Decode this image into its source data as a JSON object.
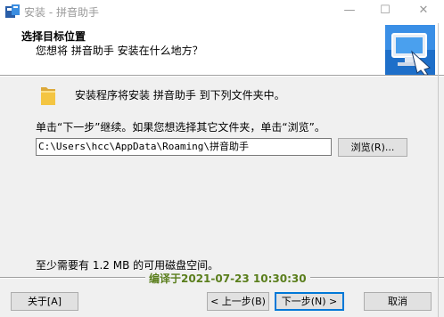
{
  "window": {
    "title": "安装 - 拼音助手",
    "minimize_glyph": "—",
    "maximize_glyph": "☐",
    "close_glyph": "✕"
  },
  "header": {
    "title": "选择目标位置",
    "subtitle": "您想将 拼音助手 安装在什么地方？"
  },
  "main": {
    "install_message": "安装程序将安装 拼音助手 到下列文件夹中。",
    "instructions": "单击“下一步”继续。如果您想选择其它文件夹，单击“浏览”。",
    "path_value": "C:\\Users\\hcc\\AppData\\Roaming\\拼音助手",
    "browse_label": "浏览(R)...",
    "space_required": "至少需要有 1.2 MB 的可用磁盘空间。"
  },
  "footer": {
    "compiled_text": "编译于2021-07-23 10:30:30",
    "about_label": "关于[A]",
    "back_label": "< 上一步(B)",
    "next_label": "下一步(N) >",
    "cancel_label": "取消"
  },
  "icons": [
    "app-icon",
    "wizard-computer-icon",
    "folder-icon"
  ],
  "colors": {
    "accent": "#0078d7",
    "compiled_text": "#5a7e1c",
    "folder": "#f4c542"
  }
}
